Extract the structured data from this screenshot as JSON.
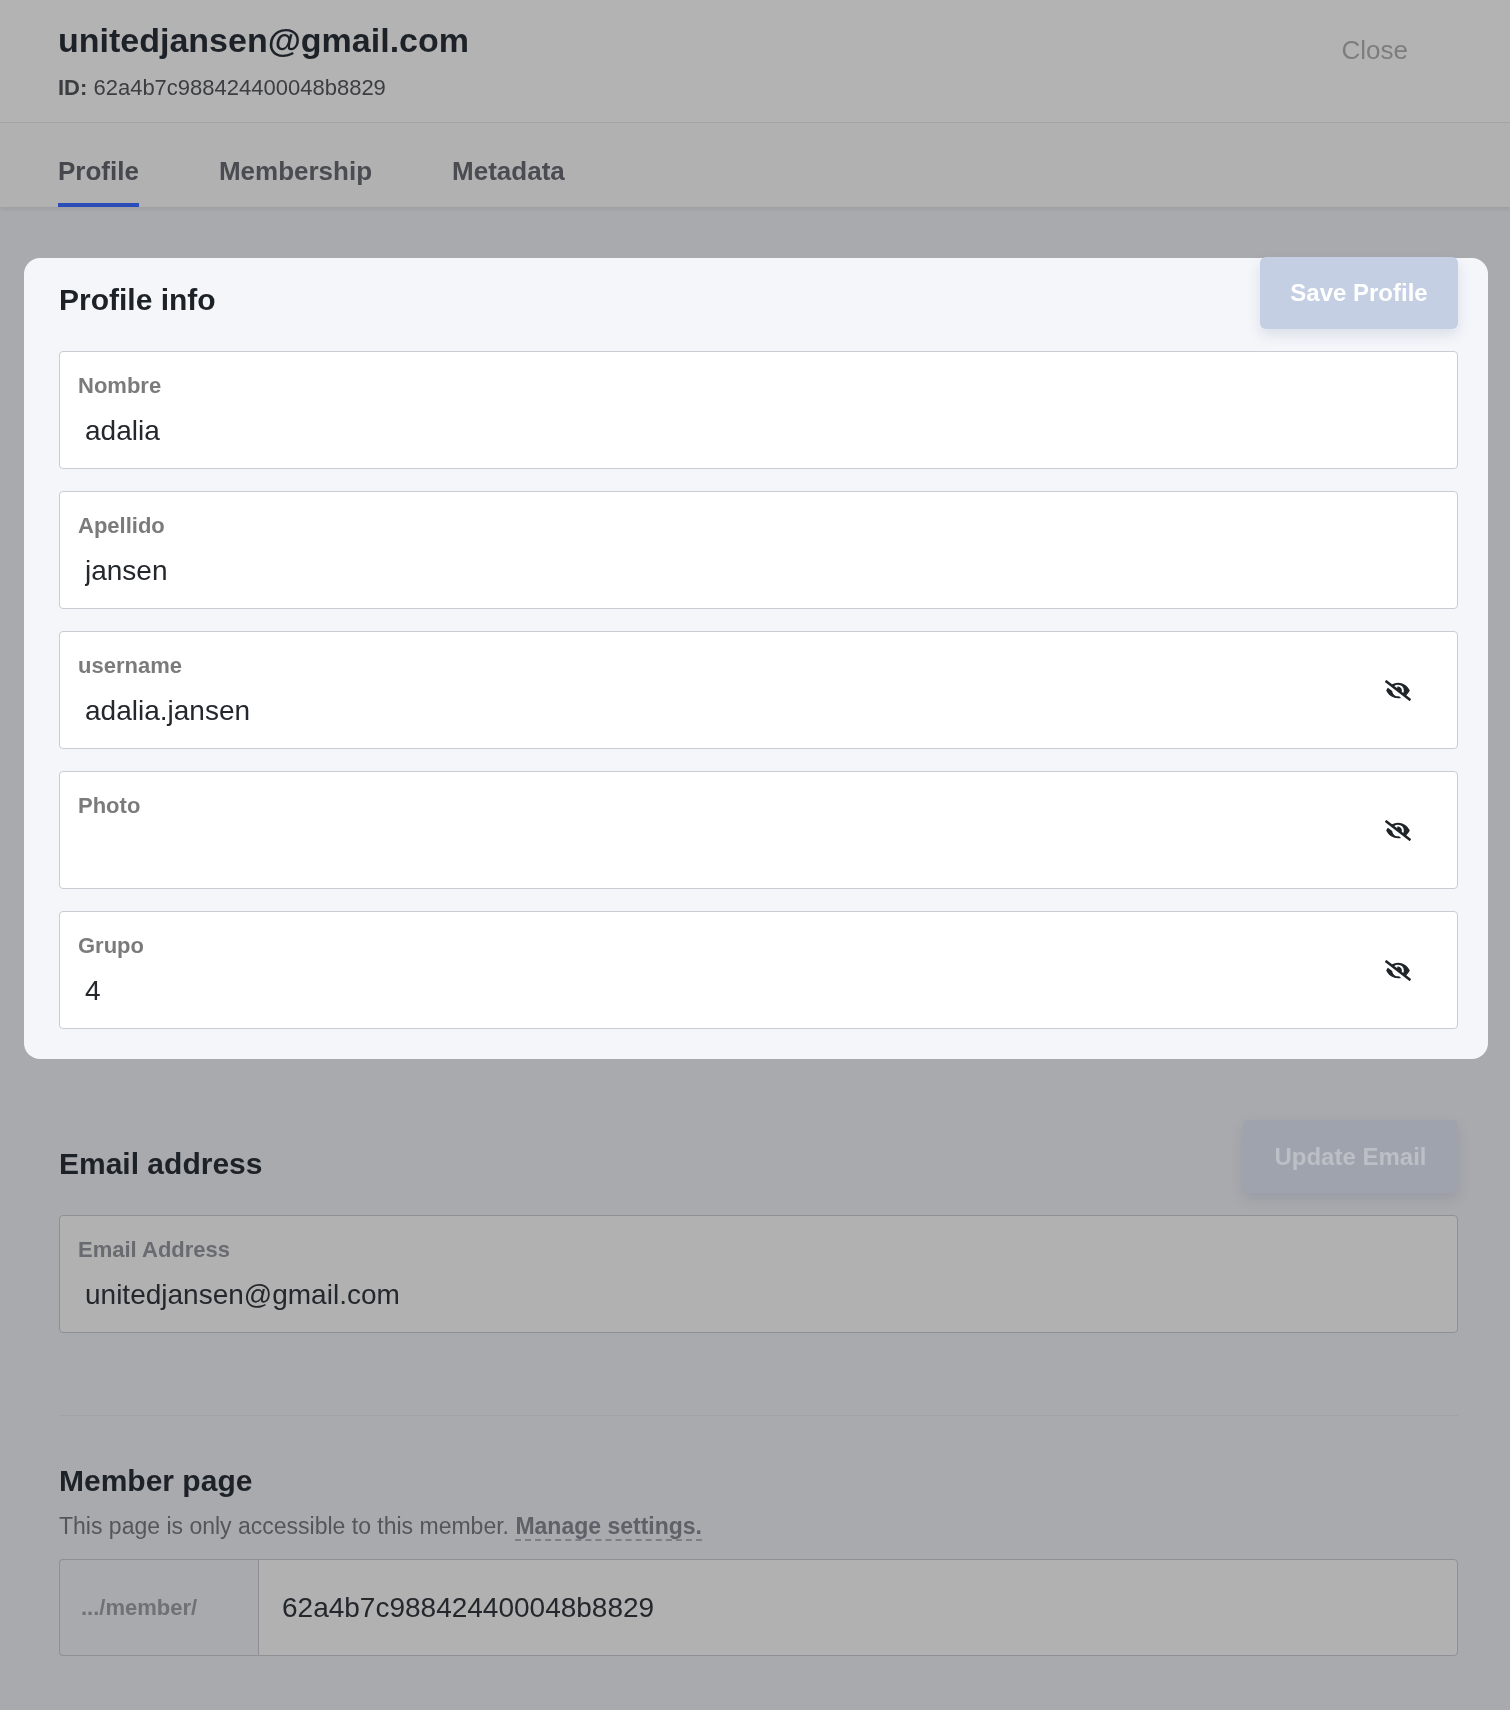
{
  "header": {
    "title": "unitedjansen@gmail.com",
    "id": "**ID:** 62a4b7c988424400048b8829",
    "close_button": "Close"
  },
  "tabs": [
    {
      "label": "Profile",
      "selected": true
    },
    {
      "label": "Membership",
      "selected": false
    },
    {
      "label": "Metadata",
      "selected": false
    }
  ],
  "profile_info": {
    "title": "Profile info",
    "save_button": {
      "label": "Save Profile",
      "disabled": true
    },
    "fields": [
      {
        "label": "Nombre",
        "value": "adalia",
        "visibility_toggle": false
      },
      {
        "label": "Apellido",
        "value": "jansen",
        "visibility_toggle": false
      },
      {
        "label": "username",
        "value": "adalia.jansen",
        "visibility_toggle": true
      },
      {
        "label": "Photo",
        "visibility_toggle": true
      },
      {
        "label": "Grupo",
        "value": "4",
        "visibility_toggle": true
      }
    ]
  },
  "email_address": {
    "title": "Email address",
    "update_button": {
      "label": "Update Email",
      "disabled": true
    },
    "field": {
      "label": "Email Address",
      "value": "unitedjansen@gmail.com"
    }
  },
  "member_page": {
    "title": "Member page",
    "description": "This page is only accessible to this member.",
    "link": "Manage settings.",
    "url_prefix": ".../member/",
    "url_value": "62a4b7c988424400048b8829"
  }
}
